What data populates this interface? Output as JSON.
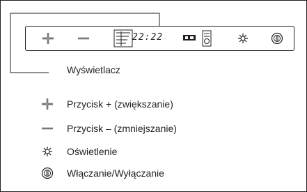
{
  "panel": {
    "time": "22:22"
  },
  "legend": {
    "display_label": "Wyświetlacz",
    "plus_label": "Przycisk + (zwiększanie)",
    "minus_label": "Przycisk – (zmniejszanie)",
    "light_label": "Oświetlenie",
    "power_label": "Włączanie/Wyłączanie"
  },
  "icons": [
    "plus-icon",
    "minus-icon",
    "fan-speed-icon",
    "timer-icon",
    "fan-mode-icon",
    "light-icon",
    "power-icon"
  ],
  "colors": {
    "line": "#231f20",
    "background": "#ffffff"
  }
}
